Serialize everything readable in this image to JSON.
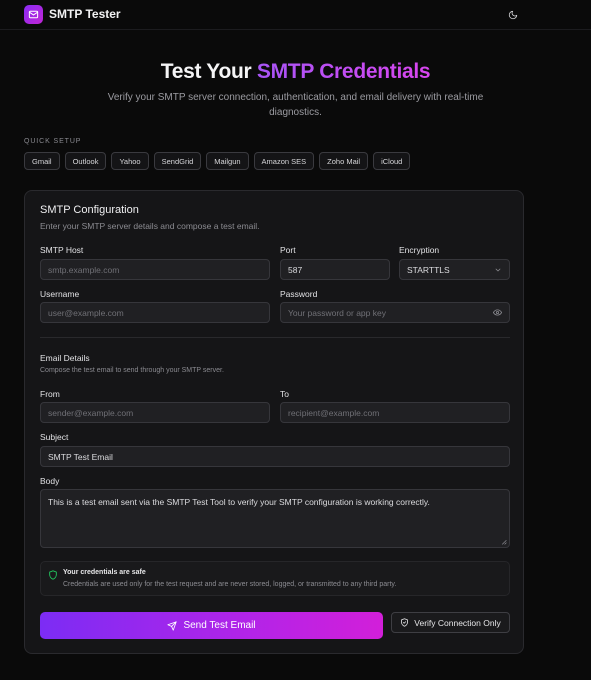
{
  "app": {
    "title": "SMTP Tester"
  },
  "hero": {
    "title_plain": "Test Your ",
    "title_accent": "SMTP Credentials",
    "subtitle": "Verify your SMTP server connection, authentication, and email delivery with real-time diagnostics."
  },
  "quick_setup": {
    "label": "QUICK SETUP",
    "presets": [
      "Gmail",
      "Outlook",
      "Yahoo",
      "SendGrid",
      "Mailgun",
      "Amazon SES",
      "Zoho Mail",
      "iCloud"
    ]
  },
  "config": {
    "title": "SMTP Configuration",
    "description": "Enter your SMTP server details and compose a test email.",
    "host": {
      "label": "SMTP Host",
      "placeholder": "smtp.example.com"
    },
    "port": {
      "label": "Port",
      "value": "587"
    },
    "encryption": {
      "label": "Encryption",
      "value": "STARTTLS"
    },
    "username": {
      "label": "Username",
      "placeholder": "user@example.com"
    },
    "password": {
      "label": "Password",
      "placeholder": "Your password or app key"
    }
  },
  "email": {
    "title": "Email Details",
    "description": "Compose the test email to send through your SMTP server.",
    "from": {
      "label": "From",
      "placeholder": "sender@example.com"
    },
    "to": {
      "label": "To",
      "placeholder": "recipient@example.com"
    },
    "subject": {
      "label": "Subject",
      "value": "SMTP Test Email"
    },
    "body": {
      "label": "Body",
      "value": "This is a test email sent via the SMTP Test Tool to verify your SMTP configuration is working correctly."
    }
  },
  "notice": {
    "title": "Your credentials are safe",
    "text": "Credentials are used only for the test request and are never stored, logged, or transmitted to any third party."
  },
  "actions": {
    "send_label": "Send Test Email",
    "verify_label": "Verify Connection Only"
  },
  "icons": {
    "logo": "mail-icon",
    "theme": "moon-icon",
    "select": "chevron-down-icon",
    "password": "eye-icon",
    "notice": "shield-icon",
    "send": "send-icon",
    "verify": "shield-check-icon"
  },
  "colors": {
    "accent_start": "#7c2cf4",
    "accent_end": "#d21fd9",
    "safe_green": "#22c55e",
    "background": "#0a0a0a",
    "card": "#151517"
  }
}
